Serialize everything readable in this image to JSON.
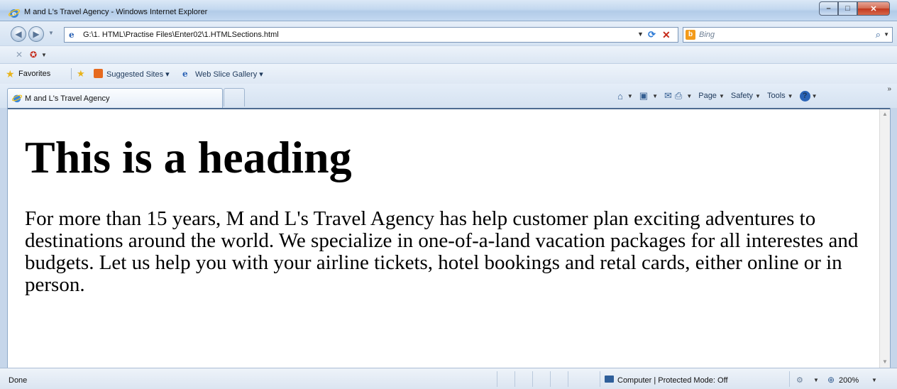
{
  "window": {
    "title": "M and L's Travel Agency - Windows Internet Explorer",
    "minimize_glyph": "–",
    "maximize_glyph": "□",
    "close_glyph": "✕"
  },
  "address_bar": {
    "url": "G:\\1. HTML\\Practise Files\\Enter02\\1.HTMLSections.html"
  },
  "search": {
    "placeholder": "Bing",
    "engine_glyph": "b"
  },
  "command_row": {
    "stop_glyph": "✕"
  },
  "favorites_bar": {
    "favorites_label": "Favorites",
    "suggested_sites_label": "Suggested Sites ▾",
    "web_slice_gallery_label": "Web Slice Gallery ▾"
  },
  "tabs": [
    {
      "label": "M and L's Travel Agency",
      "active": true
    }
  ],
  "toolbar": {
    "page_label": "Page",
    "safety_label": "Safety",
    "tools_label": "Tools",
    "help_glyph": "?",
    "overflow_glyph": "»"
  },
  "page": {
    "heading": "This is a heading",
    "paragraph": "For more than 15 years, M and L's Travel Agency has help customer plan exciting adventures to destinations around the world. We specialize in one-of-a-land vacation packages for all interestes and budgets. Let us help you with your airline tickets, hotel bookings and retal cards, either online or in person."
  },
  "status_bar": {
    "status_text": "Done",
    "zone_text": "Computer | Protected Mode: Off",
    "zoom_text": "200%"
  },
  "colors": {
    "chrome_blue": "#b9d1ea",
    "close_red": "#c2391f",
    "link_blue": "#1e395b"
  },
  "icons": {
    "ie_logo": "ie-logo-icon",
    "back": "back-arrow-icon",
    "forward": "forward-arrow-icon",
    "refresh": "refresh-icon",
    "stop": "stop-icon",
    "search": "search-icon",
    "favorites": "favorites-star-icon",
    "home": "home-icon",
    "feeds": "feeds-icon",
    "mail": "mail-icon",
    "print": "print-icon",
    "help": "help-icon",
    "zoom": "zoom-icon"
  }
}
